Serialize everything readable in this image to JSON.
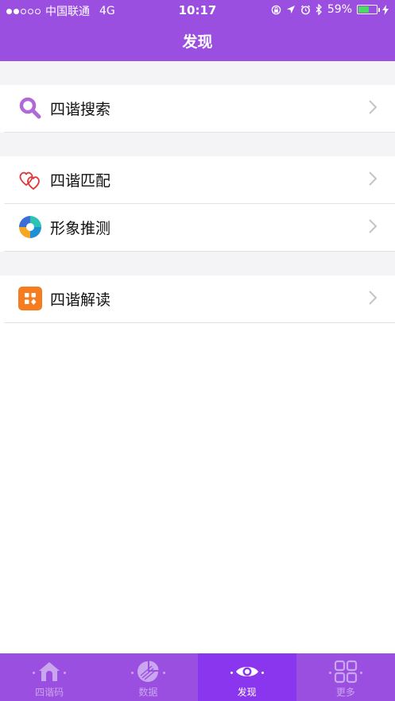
{
  "status_bar": {
    "carrier": "中国联通",
    "network": "4G",
    "time": "10:17",
    "battery": "59%",
    "battery_level": 0.59
  },
  "nav": {
    "title": "发现"
  },
  "sections": [
    {
      "items": [
        {
          "label": "四谐搜索",
          "icon": "search-icon"
        }
      ]
    },
    {
      "items": [
        {
          "label": "四谐匹配",
          "icon": "hearts-icon"
        },
        {
          "label": "形象推测",
          "icon": "aperture-icon"
        }
      ]
    },
    {
      "items": [
        {
          "label": "四谐解读",
          "icon": "apps-grid-icon"
        }
      ]
    }
  ],
  "tabbar": [
    {
      "label": "四谐码",
      "icon": "home-icon"
    },
    {
      "label": "数据",
      "icon": "pie-chart-icon"
    },
    {
      "label": "发现",
      "icon": "eye-icon",
      "active": true
    },
    {
      "label": "更多",
      "icon": "grid-icon"
    }
  ],
  "colors": {
    "primary": "#9b4fe0",
    "active_tab": "#8a36ef",
    "inactive_tab_text": "#c9a6ee"
  }
}
